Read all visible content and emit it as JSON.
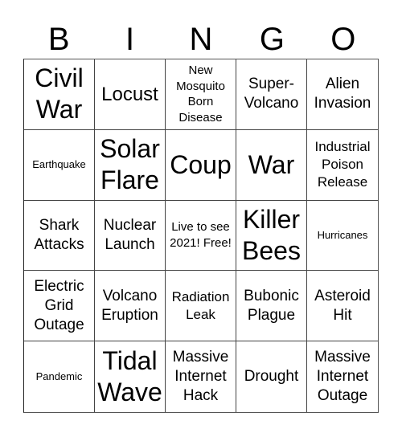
{
  "header": {
    "letters": [
      "B",
      "I",
      "N",
      "G",
      "O"
    ]
  },
  "board": {
    "cells": [
      {
        "text": "Civil War",
        "size": "xl"
      },
      {
        "text": "Locust",
        "size": "l"
      },
      {
        "text": "New Mosquito Born Disease",
        "size": "s"
      },
      {
        "text": "Super-Volcano",
        "size": "m"
      },
      {
        "text": "Alien Invasion",
        "size": "m"
      },
      {
        "text": "Earthquake",
        "size": "xs"
      },
      {
        "text": "Solar Flare",
        "size": "xl"
      },
      {
        "text": "Coup",
        "size": "xl"
      },
      {
        "text": "War",
        "size": "xl"
      },
      {
        "text": "Industrial Poison Release",
        "size": "sm"
      },
      {
        "text": "Shark Attacks",
        "size": "m"
      },
      {
        "text": "Nuclear Launch",
        "size": "m"
      },
      {
        "text": "Live to see 2021! Free!",
        "size": "s"
      },
      {
        "text": "Killer Bees",
        "size": "xl"
      },
      {
        "text": "Hurricanes",
        "size": "xs"
      },
      {
        "text": "Electric Grid Outage",
        "size": "m"
      },
      {
        "text": "Volcano Eruption",
        "size": "m"
      },
      {
        "text": "Radiation Leak",
        "size": "sm"
      },
      {
        "text": "Bubonic Plague",
        "size": "m"
      },
      {
        "text": "Asteroid Hit",
        "size": "m"
      },
      {
        "text": "Pandemic",
        "size": "xs"
      },
      {
        "text": "Tidal Wave",
        "size": "xl"
      },
      {
        "text": "Massive Internet Hack",
        "size": "m"
      },
      {
        "text": "Drought",
        "size": "m"
      },
      {
        "text": "Massive Internet Outage",
        "size": "m"
      }
    ]
  }
}
